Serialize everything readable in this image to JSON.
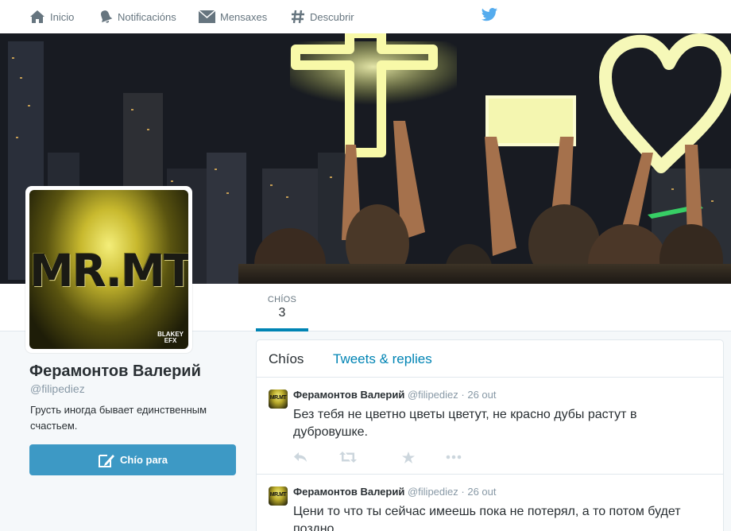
{
  "nav": {
    "home": "Inicio",
    "notifications": "Notificacións",
    "messages": "Mensaxes",
    "discover": "Descubrir"
  },
  "stats": {
    "tweets_label": "CHÍOS",
    "tweets_value": "3"
  },
  "avatar": {
    "text": "MR.MT",
    "tag_line1": "BLAKEY",
    "tag_line2": "EFX"
  },
  "profile": {
    "name": "Фeрамонтов Валерий",
    "handle": "@filipediez",
    "bio": "Грусть иногда бывает единственным счастьем.",
    "tweet_to_label": "Chío para"
  },
  "timeline": {
    "tab_tweets": "Chíos",
    "tab_replies": "Tweets & replies",
    "tweets": [
      {
        "name": "Фeрамонтов Валерий",
        "handle": "@filipediez",
        "time": "26 out",
        "text": "Без тебя не цветно цветы цветут, не красно дубы растут в дубровушке."
      },
      {
        "name": "Фeрамонтов Валерий",
        "handle": "@filipediez",
        "time": "26 out",
        "text": "Цени то что ты сейчас имеешь пока не потерял, а то потом будет поздно..."
      }
    ]
  },
  "colors": {
    "accent": "#0084b4",
    "button": "#3d99c5",
    "bird": "#55acee"
  }
}
